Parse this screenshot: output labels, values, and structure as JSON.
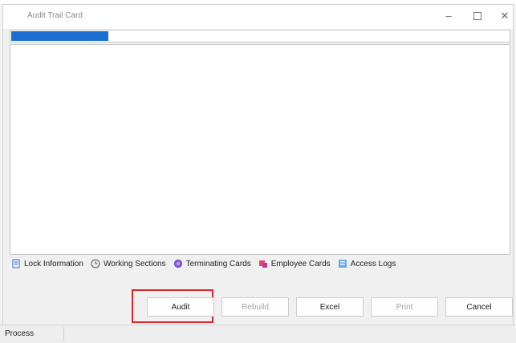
{
  "window": {
    "title": "Audit Trail Card",
    "controls": {
      "minimize": "–",
      "close": "✕"
    }
  },
  "progress": {
    "fraction": 0.195,
    "color": "#1b6fd1"
  },
  "tabs": [
    {
      "label": "Lock Information",
      "icon": "lock-info-icon"
    },
    {
      "label": "Working Sections",
      "icon": "clock-icon"
    },
    {
      "label": "Terminating Cards",
      "icon": "purple-circle-icon"
    },
    {
      "label": "Employee Cards",
      "icon": "employee-cards-icon"
    },
    {
      "label": "Access Logs",
      "icon": "access-logs-icon"
    }
  ],
  "buttons": {
    "audit": "Audit",
    "rebuild": "Rebuild",
    "excel": "Excel",
    "print": "Print",
    "cancel": "Cancel"
  },
  "highlight_color": "#d9262b",
  "status": {
    "text": "Process"
  }
}
